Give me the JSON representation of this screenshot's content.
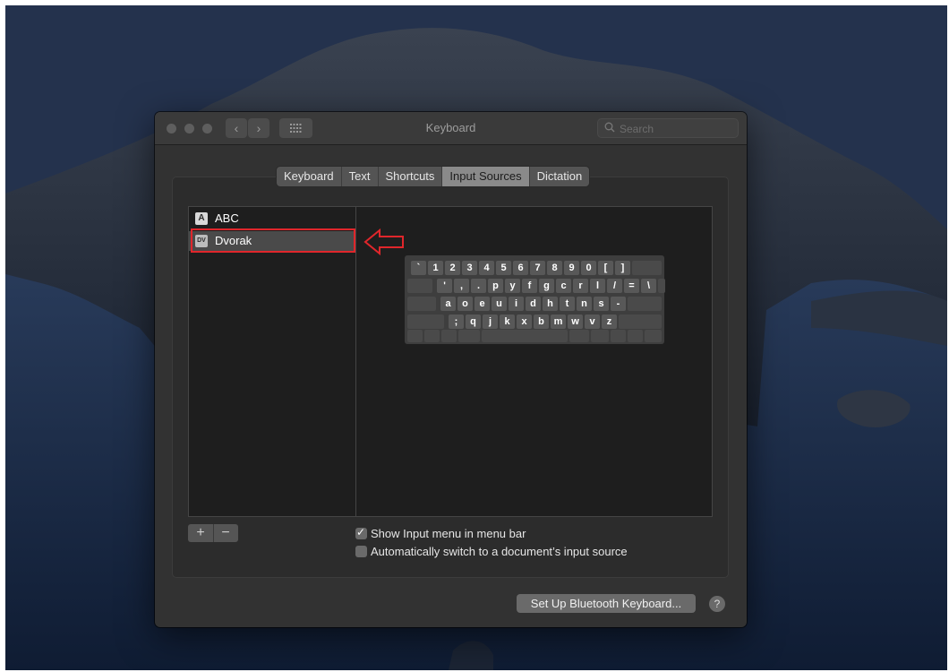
{
  "window": {
    "title": "Keyboard",
    "search_placeholder": "Search"
  },
  "tabs": [
    {
      "label": "Keyboard",
      "active": false
    },
    {
      "label": "Text",
      "active": false
    },
    {
      "label": "Shortcuts",
      "active": false
    },
    {
      "label": "Input Sources",
      "active": true
    },
    {
      "label": "Dictation",
      "active": false
    }
  ],
  "sources": [
    {
      "badge": "A",
      "label": "ABC",
      "selected": false
    },
    {
      "badge": "DV",
      "label": "Dvorak",
      "selected": true
    }
  ],
  "keyboard_rows": [
    [
      "`",
      "1",
      "2",
      "3",
      "4",
      "5",
      "6",
      "7",
      "8",
      "9",
      "0",
      "[",
      "]"
    ],
    [
      "'",
      ",",
      ".",
      "p",
      "y",
      "f",
      "g",
      "c",
      "r",
      "l",
      "/",
      "=",
      "\\"
    ],
    [
      "a",
      "o",
      "e",
      "u",
      "i",
      "d",
      "h",
      "t",
      "n",
      "s",
      "-"
    ],
    [
      ";",
      "q",
      "j",
      "k",
      "x",
      "b",
      "m",
      "w",
      "v",
      "z"
    ]
  ],
  "list_buttons": {
    "add": "+",
    "remove": "−"
  },
  "options": [
    {
      "label": "Show Input menu in menu bar",
      "checked": true
    },
    {
      "label": "Automatically switch to a document’s input source",
      "checked": false
    }
  ],
  "buttons": {
    "bluetooth": "Set Up Bluetooth Keyboard...",
    "help": "?"
  },
  "icons": {
    "search": "magnifier-icon",
    "back": "chevron-left-icon",
    "forward": "chevron-right-icon",
    "grid": "grid-icon",
    "annotation": "arrow-left-icon"
  },
  "colors": {
    "highlight": "#e0262b",
    "window_bg": "#323232"
  }
}
